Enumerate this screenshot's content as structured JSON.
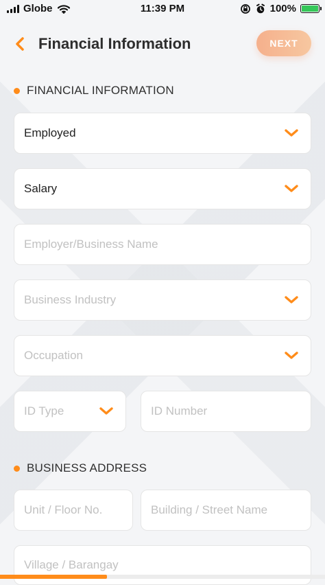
{
  "status_bar": {
    "carrier": "Globe",
    "time": "11:39 PM",
    "battery": "100%",
    "icons": [
      "signal-icon",
      "wifi-icon",
      "lock-rotation-icon",
      "alarm-icon",
      "battery-icon"
    ]
  },
  "header": {
    "title": "Financial Information",
    "back_icon": "chevron-left-icon",
    "next_label": "NEXT"
  },
  "sections": {
    "financial_title": "FINANCIAL INFORMATION",
    "business_title": "BUSINESS ADDRESS"
  },
  "form": {
    "employment_status": {
      "value": "Employed"
    },
    "source_of_funds": {
      "value": "Salary"
    },
    "employer_name": {
      "placeholder": "Employer/Business Name"
    },
    "business_industry": {
      "placeholder": "Business Industry"
    },
    "occupation": {
      "placeholder": "Occupation"
    },
    "id_type": {
      "placeholder": "ID Type"
    },
    "id_number": {
      "placeholder": "ID Number"
    },
    "unit_floor": {
      "placeholder": "Unit / Floor No."
    },
    "building_street": {
      "placeholder": "Building / Street Name"
    },
    "village_barangay": {
      "placeholder": "Village / Barangay"
    }
  },
  "progress": {
    "value": 0.33
  },
  "colors": {
    "accent": "#FF8C1A",
    "next_button": "#F5B08C",
    "battery": "#35C759"
  }
}
